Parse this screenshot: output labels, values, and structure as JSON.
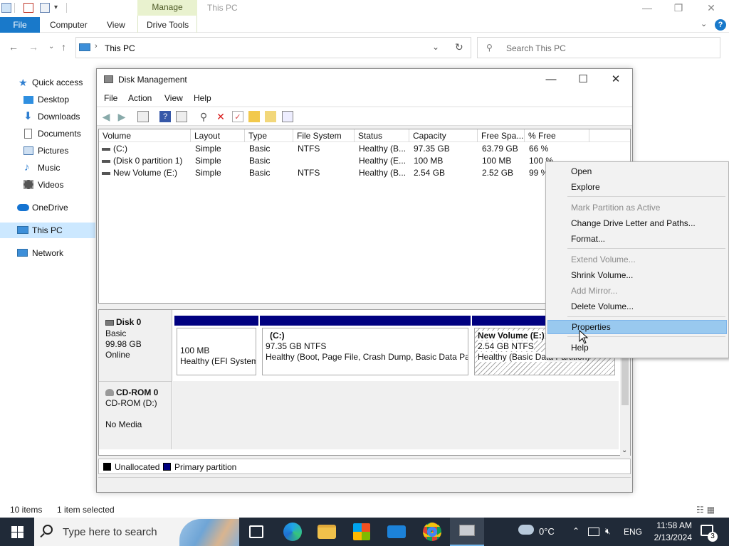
{
  "explorer": {
    "title": "This PC",
    "contextual_tab": "Manage",
    "ribbon_tabs": [
      "File",
      "Computer",
      "View",
      "Drive Tools"
    ],
    "address": "This PC",
    "search_placeholder": "Search This PC",
    "nav": [
      {
        "label": "Quick access",
        "icon": "star-icon"
      },
      {
        "label": "Desktop",
        "icon": "desktop-icon"
      },
      {
        "label": "Downloads",
        "icon": "download-icon"
      },
      {
        "label": "Documents",
        "icon": "documents-icon"
      },
      {
        "label": "Pictures",
        "icon": "pictures-icon"
      },
      {
        "label": "Music",
        "icon": "music-icon"
      },
      {
        "label": "Videos",
        "icon": "videos-icon"
      },
      {
        "label": "OneDrive",
        "icon": "cloud-icon"
      },
      {
        "label": "This PC",
        "icon": "computer-icon"
      },
      {
        "label": "Network",
        "icon": "network-icon"
      }
    ],
    "status_items": "10 items",
    "status_selected": "1 item selected"
  },
  "disk_management": {
    "title": "Disk Management",
    "menus": [
      "File",
      "Action",
      "View",
      "Help"
    ],
    "columns": [
      "Volume",
      "Layout",
      "Type",
      "File System",
      "Status",
      "Capacity",
      "Free Spa...",
      "% Free"
    ],
    "volumes": [
      [
        "(C:)",
        "Simple",
        "Basic",
        "NTFS",
        "Healthy (B...",
        "97.35 GB",
        "63.79 GB",
        "66 %"
      ],
      [
        "(Disk 0 partition 1)",
        "Simple",
        "Basic",
        "",
        "Healthy (E...",
        "100 MB",
        "100 MB",
        "100 %"
      ],
      [
        "New Volume (E:)",
        "Simple",
        "Basic",
        "NTFS",
        "Healthy (B...",
        "2.54 GB",
        "2.52 GB",
        "99 %"
      ]
    ],
    "disk0": {
      "name": "Disk 0",
      "type": "Basic",
      "size": "99.98 GB",
      "state": "Online",
      "partitions": [
        {
          "name": "",
          "line1": "100 MB",
          "line2": "Healthy (EFI System"
        },
        {
          "name": "(C:)",
          "line1": "97.35 GB NTFS",
          "line2": "Healthy (Boot, Page File, Crash Dump, Basic Data Part"
        },
        {
          "name": "New Volume  (E:)",
          "line1": "2.54 GB NTFS",
          "line2": "Healthy (Basic Data Partition)"
        }
      ]
    },
    "cdrom0": {
      "name": "CD-ROM 0",
      "drive": "CD-ROM (D:)",
      "media": "No Media"
    },
    "legend": {
      "unallocated": "Unallocated",
      "primary": "Primary partition",
      "unallocated_color": "#000000",
      "primary_color": "#000080"
    }
  },
  "context_menu": {
    "open": "Open",
    "explore": "Explore",
    "mark_active": "Mark Partition as Active",
    "change_letter": "Change Drive Letter and Paths...",
    "format": "Format...",
    "extend": "Extend Volume...",
    "shrink": "Shrink Volume...",
    "add_mirror": "Add Mirror...",
    "delete": "Delete Volume...",
    "properties": "Properties",
    "help": "Help"
  },
  "taskbar": {
    "search_placeholder": "Type here to search",
    "temperature": "0°C",
    "language": "ENG",
    "time": "11:58 AM",
    "date": "2/13/2024",
    "notification_count": "3"
  },
  "colors": {
    "accent": "#1979ca",
    "partition_bar": "#000080",
    "menu_highlight": "#99c9ef",
    "taskbar": "#202a38"
  }
}
